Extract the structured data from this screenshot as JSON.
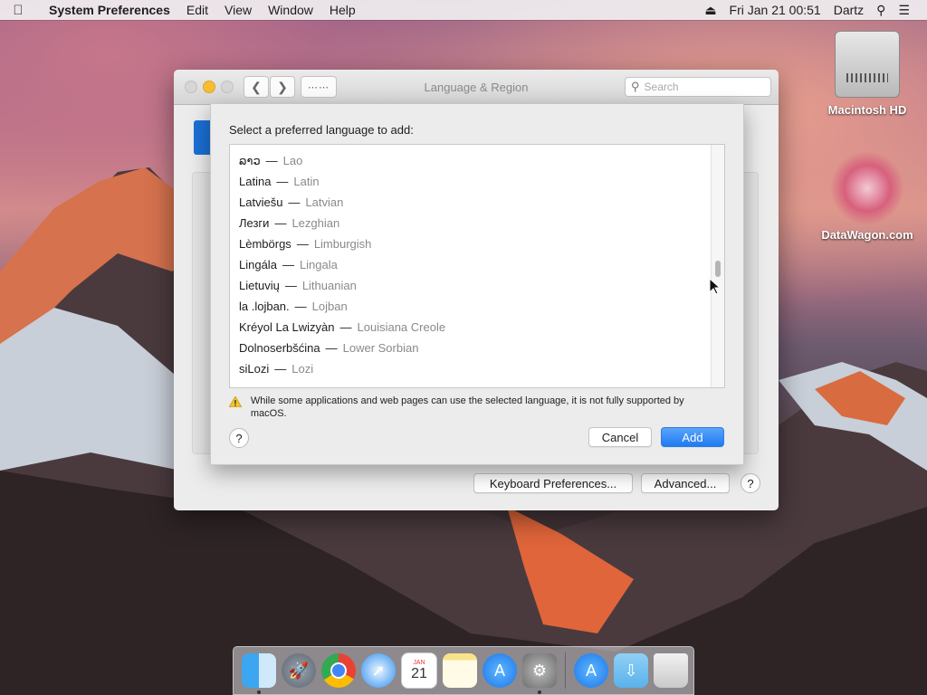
{
  "menubar": {
    "app_name": "System Preferences",
    "items": [
      "Edit",
      "View",
      "Window",
      "Help"
    ],
    "clock": "Fri Jan 21  00:51",
    "user": "Dartz"
  },
  "desktop": {
    "icons": [
      {
        "label": "Macintosh HD"
      },
      {
        "label": "DataWagon.com"
      }
    ]
  },
  "window": {
    "title": "Language & Region",
    "search_placeholder": "Search",
    "keyboard_prefs_label": "Keyboard Preferences...",
    "advanced_label": "Advanced...",
    "help_label": "?"
  },
  "sheet": {
    "prompt": "Select a preferred language to add:",
    "languages": [
      {
        "native": "ລາວ",
        "english": "Lao"
      },
      {
        "native": "Latina",
        "english": "Latin"
      },
      {
        "native": "Latviešu",
        "english": "Latvian"
      },
      {
        "native": "Лезги",
        "english": "Lezghian"
      },
      {
        "native": "Lèmbörgs",
        "english": "Limburgish"
      },
      {
        "native": "Lingála",
        "english": "Lingala"
      },
      {
        "native": "Lietuvių",
        "english": "Lithuanian"
      },
      {
        "native": "la .lojban.",
        "english": "Lojban"
      },
      {
        "native": "Kréyol La Lwizyàn",
        "english": "Louisiana Creole"
      },
      {
        "native": "Dolnoserbšćina",
        "english": "Lower Sorbian"
      },
      {
        "native": "siLozi",
        "english": "Lozi"
      }
    ],
    "separator": "—",
    "warning": "While some applications and web pages can use the selected language, it is not fully supported by macOS.",
    "help_label": "?",
    "cancel_label": "Cancel",
    "add_label": "Add"
  },
  "dock": {
    "apps": [
      "finder-icon",
      "launchpad-icon",
      "chrome-icon",
      "safari-icon",
      "calendar-icon",
      "notes-icon",
      "app-store-icon",
      "system-preferences-icon",
      "downloads-icon",
      "folder-icon",
      "trash-icon"
    ],
    "calendar": {
      "month": "JAN",
      "day": "21"
    }
  },
  "colors": {
    "accent": "#1e7bf2",
    "window_bg": "#ececec"
  }
}
